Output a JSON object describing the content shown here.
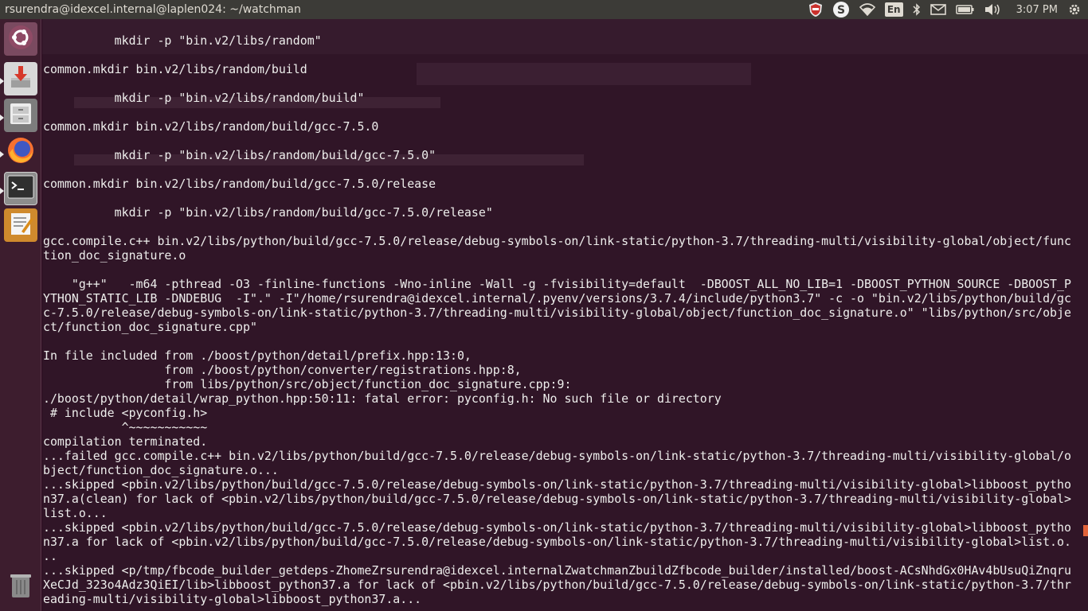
{
  "window": {
    "title": "rsurendra@idexcel.internal@laplen024: ~/watchman"
  },
  "indicators": {
    "lang": "En",
    "clock": "3:07 PM"
  },
  "launcher": {
    "items": [
      {
        "name": "ubuntu-dash",
        "icon": "ubuntu-logo-icon"
      },
      {
        "name": "software-installer",
        "icon": "installer-icon"
      },
      {
        "name": "files",
        "icon": "file-cabinet-icon"
      },
      {
        "name": "firefox",
        "icon": "firefox-icon"
      },
      {
        "name": "terminal",
        "icon": "terminal-icon"
      },
      {
        "name": "text-editor",
        "icon": "text-editor-icon"
      },
      {
        "name": "trash",
        "icon": "trash-icon"
      }
    ]
  },
  "terminal": {
    "lines": [
      "          mkdir -p \"bin.v2/libs/random\"",
      "",
      "common.mkdir bin.v2/libs/random/build",
      "",
      "          mkdir -p \"bin.v2/libs/random/build\"",
      "",
      "common.mkdir bin.v2/libs/random/build/gcc-7.5.0",
      "",
      "          mkdir -p \"bin.v2/libs/random/build/gcc-7.5.0\"",
      "",
      "common.mkdir bin.v2/libs/random/build/gcc-7.5.0/release",
      "",
      "          mkdir -p \"bin.v2/libs/random/build/gcc-7.5.0/release\"",
      "",
      "gcc.compile.c++ bin.v2/libs/python/build/gcc-7.5.0/release/debug-symbols-on/link-static/python-3.7/threading-multi/visibility-global/object/func",
      "tion_doc_signature.o",
      "",
      "    \"g++\"   -m64 -pthread -O3 -finline-functions -Wno-inline -Wall -g -fvisibility=default  -DBOOST_ALL_NO_LIB=1 -DBOOST_PYTHON_SOURCE -DBOOST_P",
      "YTHON_STATIC_LIB -DNDEBUG  -I\".\" -I\"/home/rsurendra@idexcel.internal/.pyenv/versions/3.7.4/include/python3.7\" -c -o \"bin.v2/libs/python/build/gc",
      "c-7.5.0/release/debug-symbols-on/link-static/python-3.7/threading-multi/visibility-global/object/function_doc_signature.o\" \"libs/python/src/obje",
      "ct/function_doc_signature.cpp\"",
      "",
      "In file included from ./boost/python/detail/prefix.hpp:13:0,",
      "                 from ./boost/python/converter/registrations.hpp:8,",
      "                 from libs/python/src/object/function_doc_signature.cpp:9:",
      "./boost/python/detail/wrap_python.hpp:50:11: fatal error: pyconfig.h: No such file or directory",
      " # include <pyconfig.h>",
      "           ^~~~~~~~~~~~",
      "compilation terminated.",
      "...failed gcc.compile.c++ bin.v2/libs/python/build/gcc-7.5.0/release/debug-symbols-on/link-static/python-3.7/threading-multi/visibility-global/o",
      "bject/function_doc_signature.o...",
      "...skipped <pbin.v2/libs/python/build/gcc-7.5.0/release/debug-symbols-on/link-static/python-3.7/threading-multi/visibility-global>libboost_pytho",
      "n37.a(clean) for lack of <pbin.v2/libs/python/build/gcc-7.5.0/release/debug-symbols-on/link-static/python-3.7/threading-multi/visibility-global>",
      "list.o...",
      "...skipped <pbin.v2/libs/python/build/gcc-7.5.0/release/debug-symbols-on/link-static/python-3.7/threading-multi/visibility-global>libboost_pytho",
      "n37.a for lack of <pbin.v2/libs/python/build/gcc-7.5.0/release/debug-symbols-on/link-static/python-3.7/threading-multi/visibility-global>list.o.",
      "..",
      "...skipped <p/tmp/fbcode_builder_getdeps-ZhomeZrsurendra@idexcel.internalZwatchmanZbuildZfbcode_builder/installed/boost-ACsNhdGx0HAv4bUsuQiZnqru",
      "XeCJd_323o4Adz3QiEI/lib>libboost_python37.a for lack of <pbin.v2/libs/python/build/gcc-7.5.0/release/debug-symbols-on/link-static/python-3.7/thr",
      "eading-multi/visibility-global>libboost_python37.a..."
    ]
  }
}
